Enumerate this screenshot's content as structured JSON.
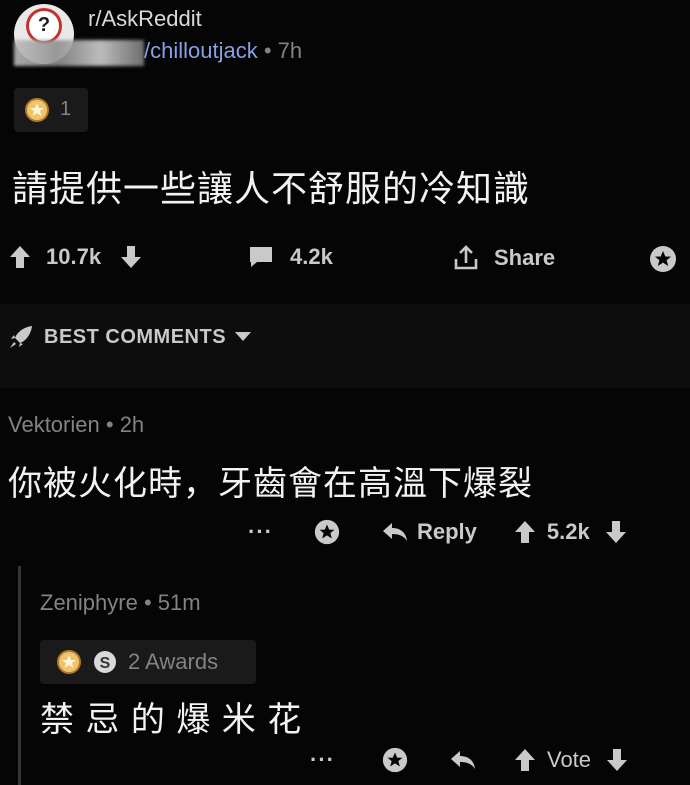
{
  "post": {
    "subreddit": "r/AskReddit",
    "author": "/chilloutjack",
    "separator": "•",
    "age": "7h",
    "award_count": "1",
    "title": "請提供一些讓人不舒服的冷知識",
    "upvotes": "10.7k",
    "comments": "4.2k",
    "share_label": "Share"
  },
  "sort": {
    "label": "BEST COMMENTS"
  },
  "comments": [
    {
      "author": "Vektorien",
      "separator": "•",
      "age": "2h",
      "body": "你被火化時，牙齒會在高溫下爆裂",
      "more": "···",
      "reply_label": "Reply",
      "score": "5.2k"
    },
    {
      "author": "Zeniphyre",
      "separator": "•",
      "age": "51m",
      "awards_label": "2 Awards",
      "body": "禁 忌 的 爆 米 花",
      "more": "···",
      "vote_label": "Vote"
    }
  ],
  "colors": {
    "background": "#050505",
    "text": "#d7dadc",
    "muted": "#818384",
    "username": "#8a9fe6",
    "subreddit_icon_ring": "#c4322d"
  }
}
